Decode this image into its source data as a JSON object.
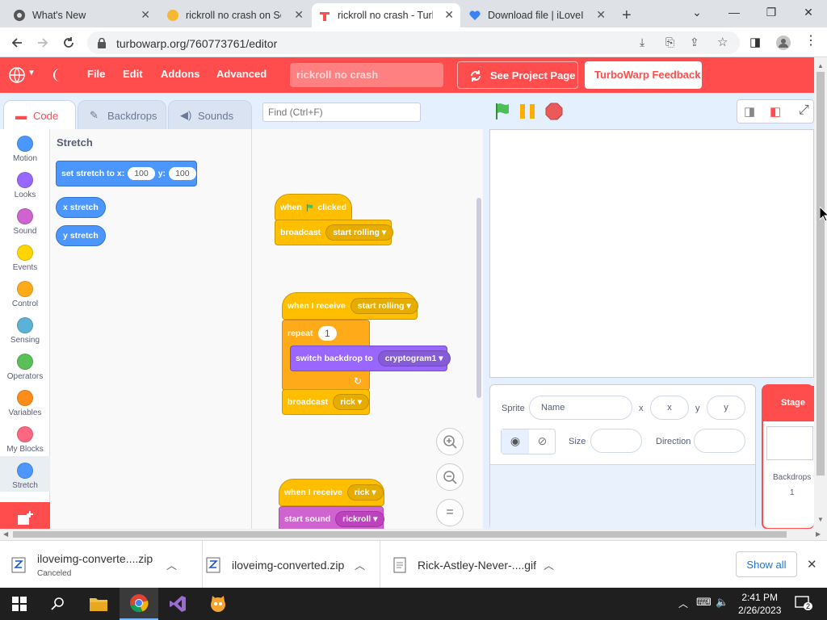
{
  "browser": {
    "tabs": [
      {
        "title": "What's New",
        "icon": "chrome-icon"
      },
      {
        "title": "rickroll no crash on Scr",
        "icon": "scratch-cat-icon"
      },
      {
        "title": "rickroll no crash - Turb",
        "icon": "turbowarp-icon"
      },
      {
        "title": "Download file | iLoveIM",
        "icon": "iloveimg-icon"
      }
    ],
    "url": "turbowarp.org/760773761/editor"
  },
  "menu": {
    "items": [
      "File",
      "Edit",
      "Addons",
      "Advanced"
    ],
    "project_title": "rickroll no crash",
    "see_project_page": "See Project Page",
    "feedback": "TurboWarp Feedback"
  },
  "editor": {
    "tabs": [
      "Code",
      "Backdrops",
      "Sounds"
    ],
    "find_placeholder": "Find (Ctrl+F)",
    "categories": [
      {
        "label": "Motion",
        "color": "#4c97ff"
      },
      {
        "label": "Looks",
        "color": "#9966ff"
      },
      {
        "label": "Sound",
        "color": "#cf63cf"
      },
      {
        "label": "Events",
        "color": "#ffd500"
      },
      {
        "label": "Control",
        "color": "#ffab19"
      },
      {
        "label": "Sensing",
        "color": "#5cb1d6"
      },
      {
        "label": "Operators",
        "color": "#59c059"
      },
      {
        "label": "Variables",
        "color": "#ff8c1a"
      },
      {
        "label": "My Blocks",
        "color": "#ff6680"
      },
      {
        "label": "Stretch",
        "color": "#4c97ff"
      }
    ],
    "palette": {
      "heading": "Stretch",
      "set_block": {
        "label": "set stretch to x:",
        "x": "100",
        "ylabel": "y:",
        "y": "100"
      },
      "x_reporter": "x stretch",
      "y_reporter": "y stretch"
    },
    "scripts": {
      "s1": {
        "hat": "when",
        "hat2": "clicked",
        "broadcast": "broadcast",
        "msg": "start rolling"
      },
      "s2": {
        "hat": "when I receive",
        "msg": "start rolling",
        "repeat": "repeat",
        "count": "1",
        "switch": "switch backdrop to",
        "backdrop": "cryptogram1",
        "broadcast": "broadcast",
        "msg2": "rick"
      },
      "s3": {
        "hat": "when I receive",
        "msg": "rick",
        "sound": "start sound",
        "snd": "rickroll"
      }
    },
    "zoom": {
      "in": "+",
      "out": "−",
      "reset": "="
    }
  },
  "sprite_info": {
    "sprite_label": "Sprite",
    "name_placeholder": "Name",
    "x_label": "x",
    "x_placeholder": "x",
    "y_label": "y",
    "y_placeholder": "y",
    "size_label": "Size",
    "direction_label": "Direction"
  },
  "stage_panel": {
    "title": "Stage",
    "backdrops_label": "Backdrops",
    "backdrops_count": "1"
  },
  "downloads": [
    {
      "name": "iloveimg-converte....zip",
      "status": "Canceled"
    },
    {
      "name": "iloveimg-converted.zip",
      "status": ""
    },
    {
      "name": "Rick-Astley-Never-....gif",
      "status": ""
    }
  ],
  "show_all": "Show all",
  "clock": {
    "time": "2:41 PM",
    "date": "2/26/2023"
  },
  "colors": {
    "accent": "#ff4c4c",
    "event": "#ffbf00",
    "control": "#ffab19",
    "looks": "#9966ff",
    "sound": "#cf63cf",
    "extension": "#4c97ff"
  }
}
